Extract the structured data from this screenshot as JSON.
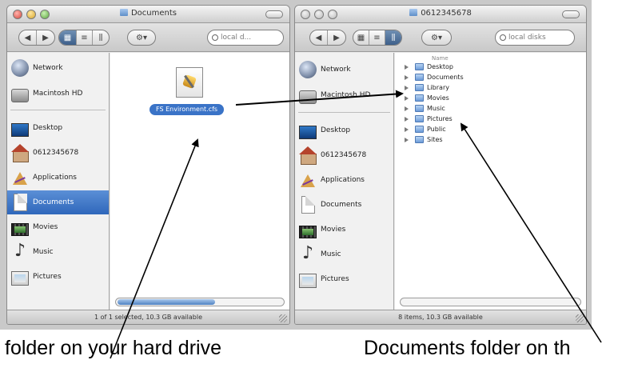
{
  "left_window": {
    "title": "Documents",
    "search_placeholder": "local d...",
    "sidebar": [
      {
        "label": "Network",
        "icon": "network-icon"
      },
      {
        "label": "Macintosh HD",
        "icon": "hard-drive-icon"
      },
      {
        "label": "Desktop",
        "icon": "desktop-icon"
      },
      {
        "label": "0612345678",
        "icon": "home-icon"
      },
      {
        "label": "Applications",
        "icon": "applications-icon"
      },
      {
        "label": "Documents",
        "icon": "documents-icon",
        "selected": true
      },
      {
        "label": "Movies",
        "icon": "movies-icon"
      },
      {
        "label": "Music",
        "icon": "music-icon"
      },
      {
        "label": "Pictures",
        "icon": "pictures-icon"
      }
    ],
    "file": {
      "name": "FS Environment.cfs",
      "icon": "file-icon"
    },
    "status": "1 of 1 selected, 10.3 GB available"
  },
  "right_window": {
    "title": "0612345678",
    "search_placeholder": "local disks",
    "sidebar": [
      {
        "label": "Network",
        "icon": "network-icon"
      },
      {
        "label": "Macintosh HD",
        "icon": "hard-drive-icon"
      },
      {
        "label": "Desktop",
        "icon": "desktop-icon"
      },
      {
        "label": "0612345678",
        "icon": "home-icon"
      },
      {
        "label": "Applications",
        "icon": "applications-icon"
      },
      {
        "label": "Documents",
        "icon": "documents-icon"
      },
      {
        "label": "Movies",
        "icon": "movies-icon"
      },
      {
        "label": "Music",
        "icon": "music-icon"
      },
      {
        "label": "Pictures",
        "icon": "pictures-icon"
      }
    ],
    "list_header": "Name",
    "items": [
      "Desktop",
      "Documents",
      "Library",
      "Movies",
      "Music",
      "Pictures",
      "Public",
      "Sites"
    ],
    "status": "8 items, 10.3 GB available"
  },
  "captions": {
    "left": "folder on your hard drive",
    "right": "Documents folder on th"
  },
  "colors": {
    "selection": "#3a73c7",
    "window_bg": "#e9e9e9"
  }
}
